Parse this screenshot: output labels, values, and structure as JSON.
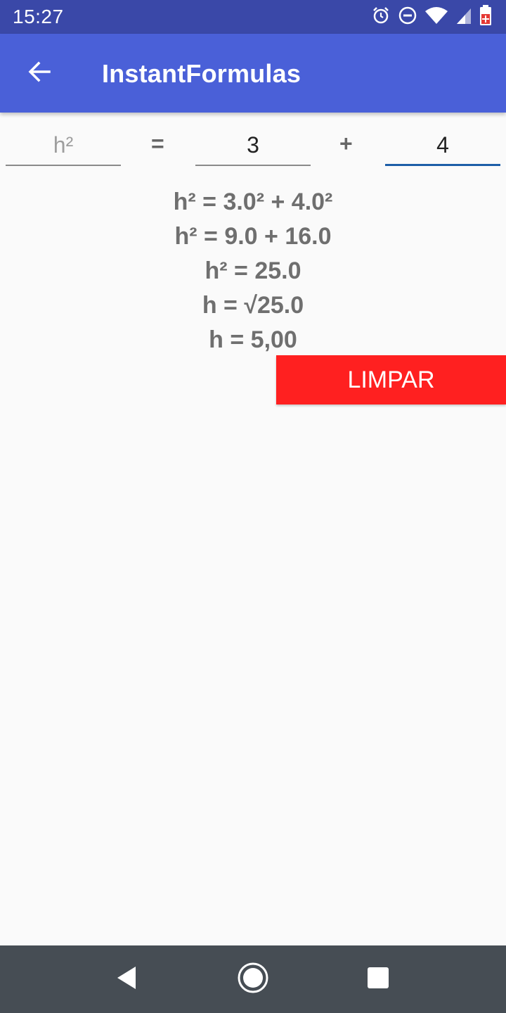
{
  "status_bar": {
    "time": "15:27",
    "icons": [
      "alarm-icon",
      "do-not-disturb-icon",
      "wifi-icon",
      "signal-icon",
      "battery-icon"
    ]
  },
  "app_bar": {
    "title": "InstantFormulas",
    "back_icon": "arrow-back-icon"
  },
  "formula": {
    "hypotenuse_placeholder": "h²",
    "equals": "=",
    "plus": "+",
    "a_value": "3",
    "b_value": "4"
  },
  "results": [
    "h² = 3.0² + 4.0²",
    "h² = 9.0 + 16.0",
    "h² = 25.0",
    "h = √25.0",
    "h = 5,00"
  ],
  "clear_button": {
    "label": "LIMPAR",
    "color": "#ff2020"
  },
  "nav_bar": {
    "icons": [
      "nav-back-icon",
      "nav-home-icon",
      "nav-recent-icon"
    ]
  },
  "colors": {
    "status_bar": "#3a48a8",
    "app_bar": "#4a60d8",
    "active_underline": "#1d5ea8",
    "background": "#fafafa"
  }
}
